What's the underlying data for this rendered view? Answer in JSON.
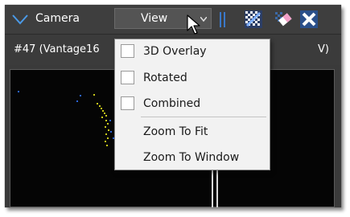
{
  "toolbar": {
    "camera_label": "Camera",
    "view_label": "View",
    "icons": [
      "chevron-down-icon",
      "dropdown-arrow-icon",
      "grid-toggle-icon",
      "eraser-icon",
      "close-icon"
    ],
    "accent_color": "#3a78c8"
  },
  "panel": {
    "title": "#47 (Vantage16",
    "title_tail": "V)"
  },
  "view_menu": {
    "items": [
      {
        "label": "3D Overlay",
        "checked": false
      },
      {
        "label": "Rotated",
        "checked": false
      },
      {
        "label": "Combined",
        "checked": false
      },
      {
        "label": "Zoom To Fit"
      },
      {
        "label": "Zoom To Window"
      }
    ]
  },
  "colors": {
    "point_blue": "#2a64d8",
    "point_yellow": "#c8c81a"
  }
}
